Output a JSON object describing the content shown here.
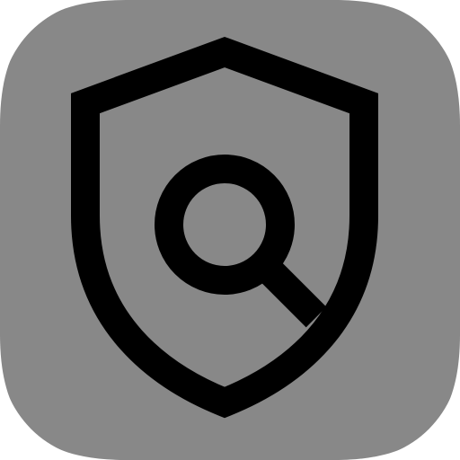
{
  "app_icon": {
    "icon": "shield-search-icon",
    "background_color": "#888888",
    "foreground_color": "#000000"
  }
}
